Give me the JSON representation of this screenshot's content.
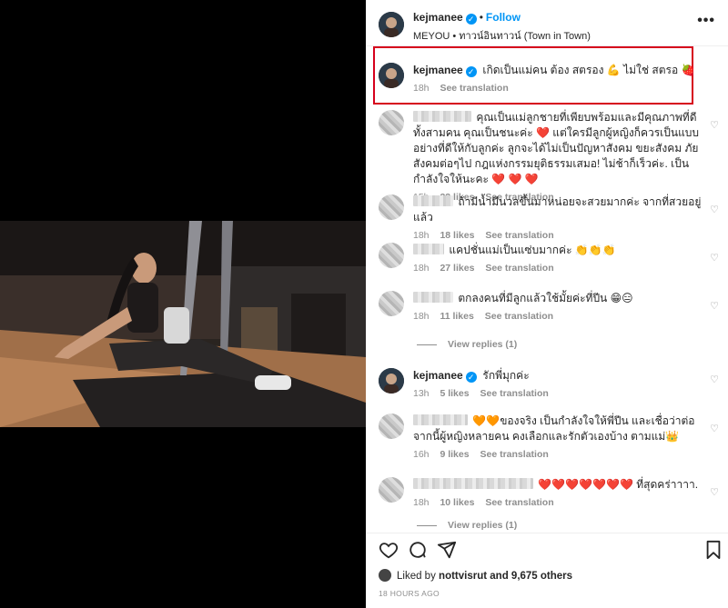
{
  "post": {
    "username": "kejmanee",
    "follow_label": "Follow",
    "location": "MEYOU • ทาวน์อินทาวน์ (Town in Town)",
    "more_label": "•••"
  },
  "caption": {
    "username": "kejmanee",
    "text": "เกิดเป็นแม่คน ต้อง สตรอง 💪 ไม่ใช่ สตรอ 🍓",
    "time": "18h",
    "translate": "See translation"
  },
  "comments": [
    {
      "text": "คุณเป็นแม่ลูกชายที่เพียบพร้อมและมีคุณภาพที่ดีทั้งสามคน คุณเป็นชนะค่ะ ❤️ แต่ใครมีลูกผู้หญิงก็ควรเป็นแบบอย่างที่ดีให้กับลูกค่ะ ลูกจะได้ไม่เป็นปัญหาสังคม ขยะสังคม ภัยสังคมต่อๆไป กฎแห่งกรรมยุติธรรมเสมอ! ไม่ช้าก็เร็วค่ะ. เป็นกำลังใจให้นะคะ ❤️ ❤️ ❤️",
      "time": "15h",
      "likes": "22 likes",
      "translate": "See translation"
    },
    {
      "text": "ถ้ามีน้ำมีนวลขึ้นมาหน่อยจะสวยมากค่ะ จากที่สวยอยู่แล้ว",
      "time": "18h",
      "likes": "18 likes",
      "translate": "See translation"
    },
    {
      "text": "แคปชั่นแม่เป็นแซ่บมากค่ะ 👏👏👏",
      "time": "18h",
      "likes": "27 likes",
      "translate": "See translation"
    },
    {
      "text": "ตกลงคนที่มีลูกแล้วใช้มั้ยค่ะที่ปีน 😁😑",
      "time": "18h",
      "likes": "11 likes",
      "translate": "See translation",
      "view_replies": "View replies (1)"
    },
    {
      "username": "kejmanee",
      "text": "รักพี่มุกค่ะ",
      "time": "13h",
      "likes": "5 likes",
      "translate": "See translation"
    },
    {
      "text": "🧡🧡ของจริง เป็นกำลังใจให้พี่ปีน และเชื่อว่าต่อจากนี้ผู้หญิงหลายคน คงเลือกและรักตัวเองบ้าง ตามแม่👑",
      "time": "16h",
      "likes": "9 likes",
      "translate": "See translation"
    },
    {
      "text": "❤️❤️❤️❤️❤️❤️❤️ ที่สุดคร่าาาา.",
      "time": "18h",
      "likes": "10 likes",
      "translate": "See translation",
      "view_replies": "View replies (1)"
    }
  ],
  "footer": {
    "liked_by_prefix": "Liked by",
    "liked_by_user": "nottvisrut",
    "liked_by_suffix": "and 9,675 others",
    "timestamp": "18 HOURS AGO"
  },
  "icons": [
    "heart-icon",
    "comment-icon",
    "share-icon",
    "save-icon",
    "more-icon",
    "verified-icon"
  ],
  "colors": {
    "accent": "#0095f6",
    "highlight_box": "#d6001c",
    "heart": "#ed1c24",
    "muted": "#8e8e8e"
  }
}
